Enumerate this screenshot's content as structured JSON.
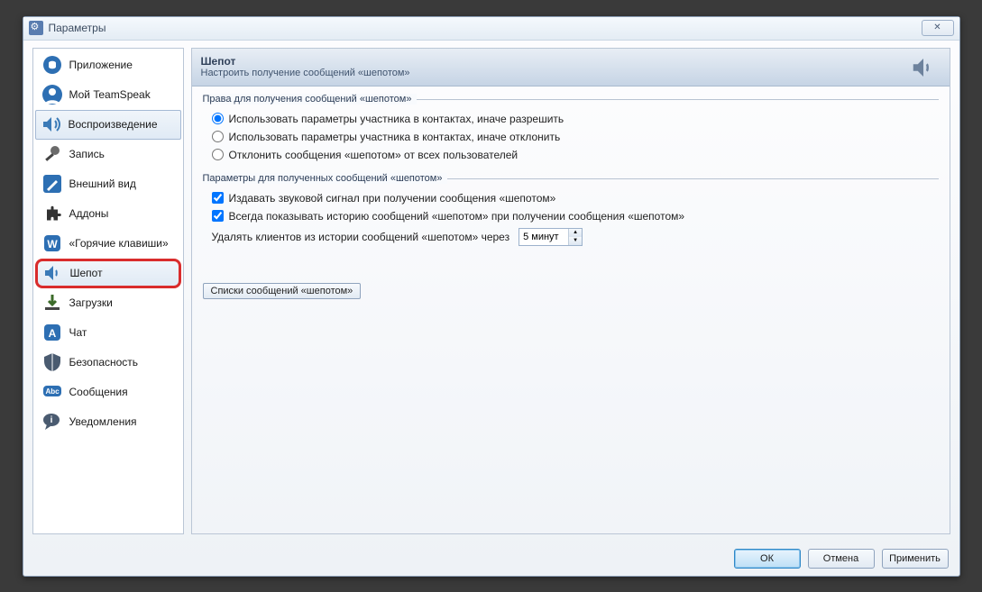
{
  "window": {
    "title": "Параметры",
    "close_char": "✕"
  },
  "sidebar": {
    "items": [
      {
        "label": "Приложение"
      },
      {
        "label": "Мой TeamSpeak"
      },
      {
        "label": "Воспроизведение"
      },
      {
        "label": "Запись"
      },
      {
        "label": "Внешний вид"
      },
      {
        "label": "Аддоны"
      },
      {
        "label": "«Горячие клавиши»"
      },
      {
        "label": "Шепот"
      },
      {
        "label": "Загрузки"
      },
      {
        "label": "Чат"
      },
      {
        "label": "Безопасность"
      },
      {
        "label": "Сообщения"
      },
      {
        "label": "Уведомления"
      }
    ]
  },
  "header": {
    "title": "Шепот",
    "description": "Настроить получение сообщений «шепотом»"
  },
  "group_rights": {
    "legend": "Права для получения сообщений «шепотом»",
    "opt1": "Использовать параметры участника в контактах, иначе разрешить",
    "opt2": "Использовать параметры участника в контактах, иначе отклонить",
    "opt3": "Отклонить сообщения «шепотом» от всех пользователей"
  },
  "group_params": {
    "legend": "Параметры для полученных сообщений «шепотом»",
    "chk1": "Издавать звуковой сигнал при получении сообщения «шепотом»",
    "chk2": "Всегда показывать историю сообщений «шепотом» при получении сообщения «шепотом»",
    "clear_label": "Удалять клиентов из истории сообщений «шепотом» через",
    "clear_value": "5 минут"
  },
  "whisper_lists_button": "Списки сообщений «шепотом»",
  "footer": {
    "ok": "ОК",
    "cancel": "Отмена",
    "apply": "Применить"
  }
}
